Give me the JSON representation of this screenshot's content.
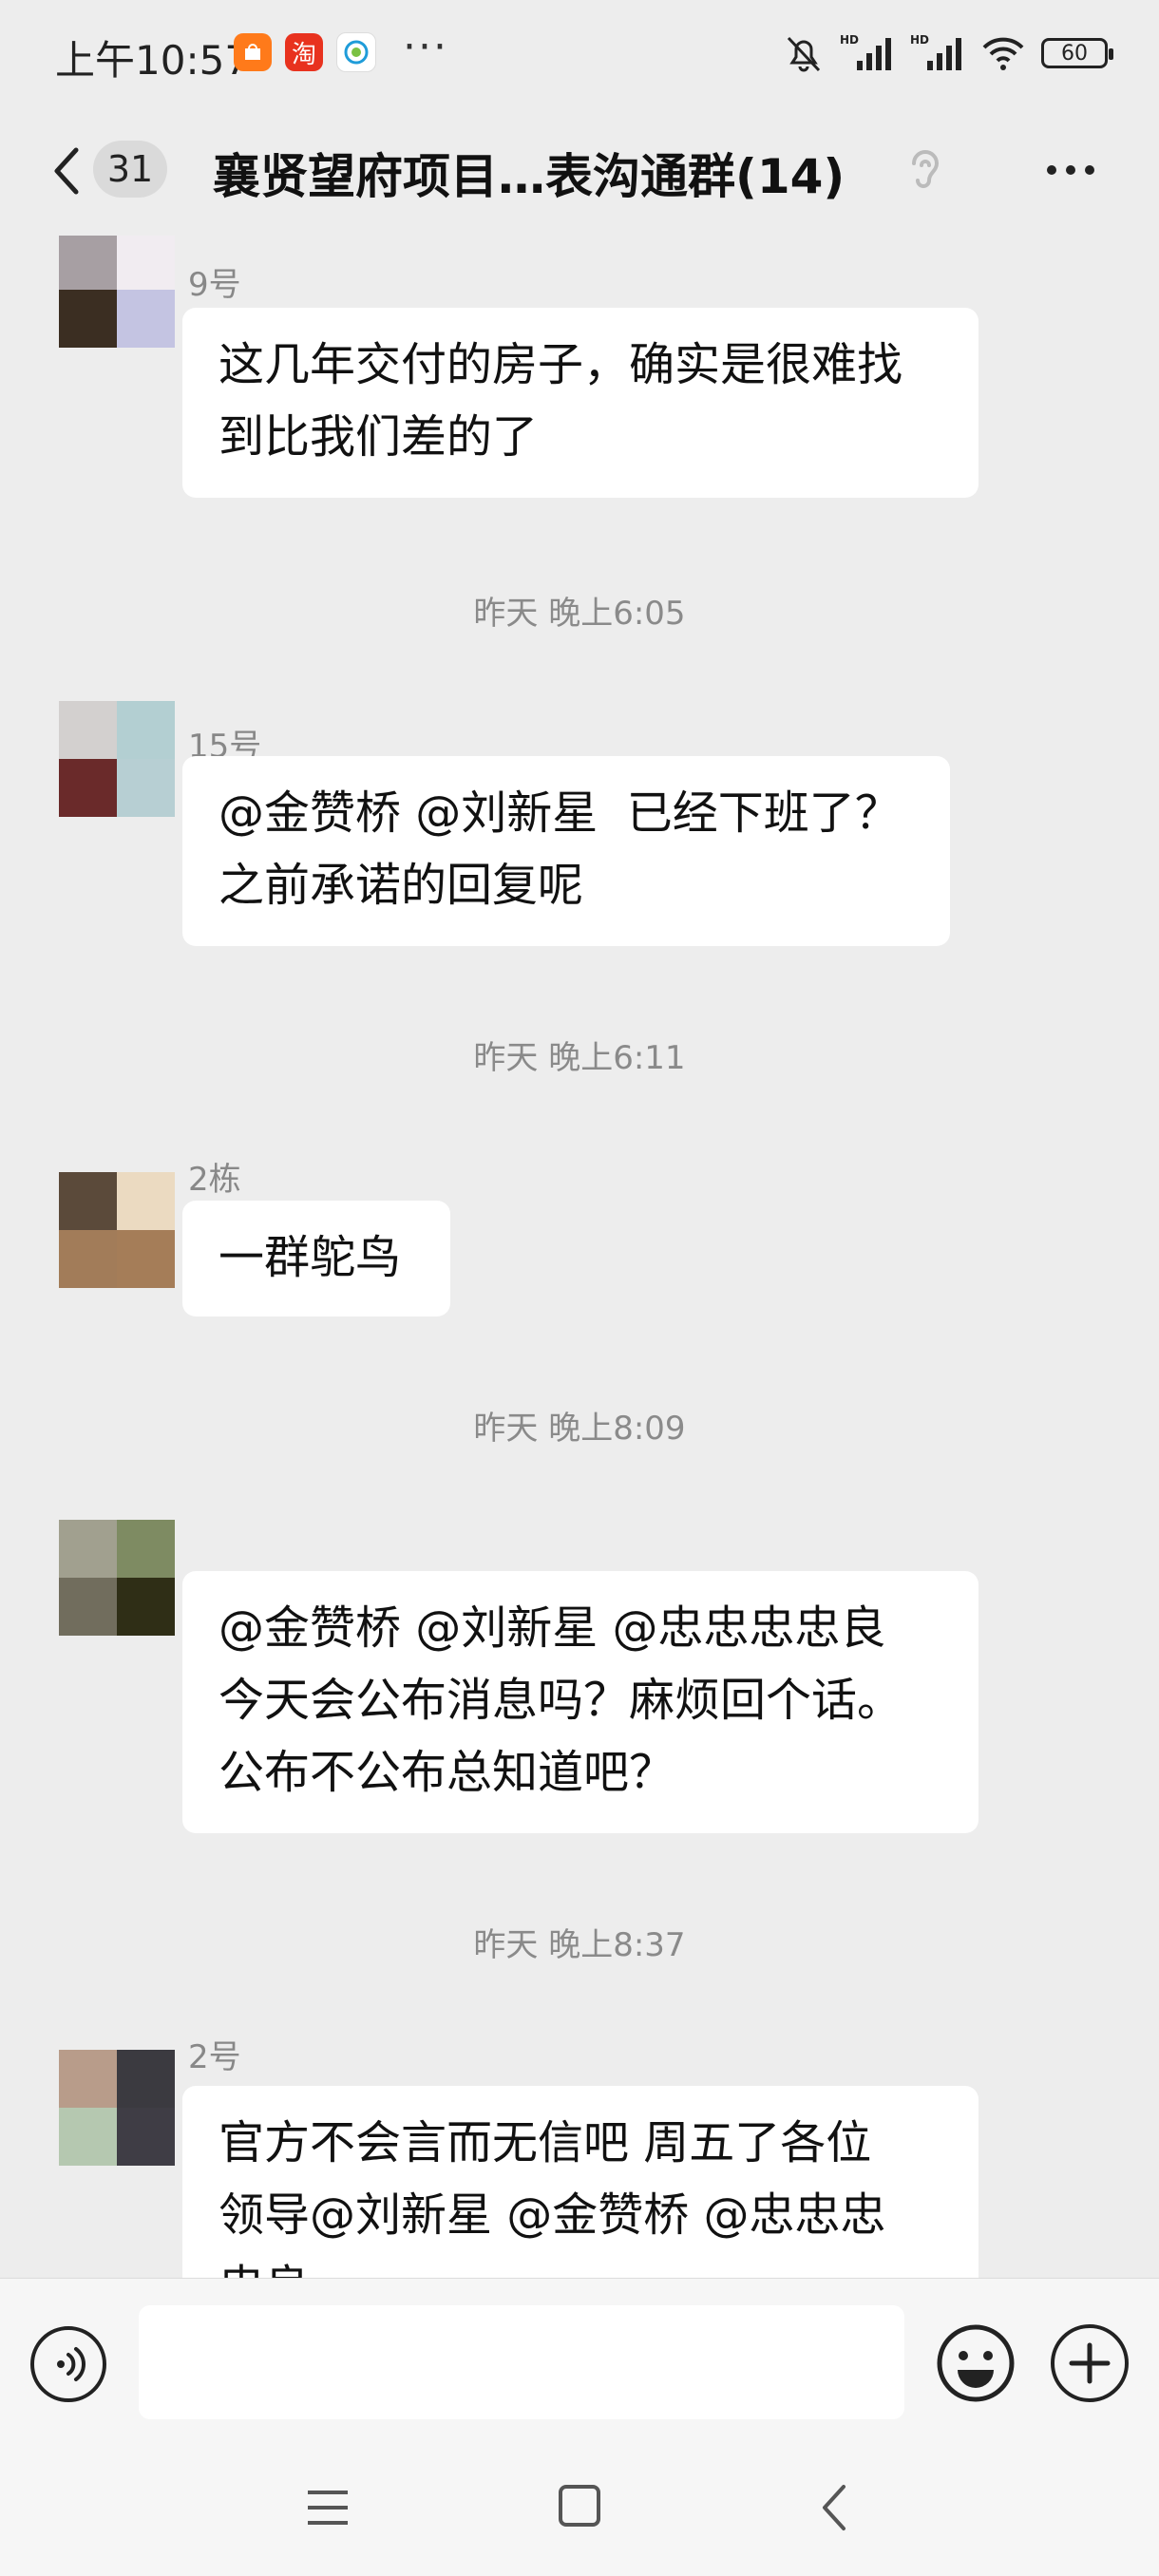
{
  "status_bar": {
    "time": "上午10:57",
    "app_icons": [
      {
        "name": "mi-store-icon",
        "color": "#ff7a1a",
        "glyph": "mi"
      },
      {
        "name": "taobao-icon",
        "color": "#e8321e",
        "glyph": "淘"
      },
      {
        "name": "china-mobile-icon",
        "color": "#ffffff",
        "glyph": ""
      }
    ],
    "more": "···",
    "signal_label_1": "HD",
    "signal_label_2": "HD",
    "battery": "60"
  },
  "header": {
    "unread_count": "31",
    "title": "襄贤望府项目…表沟通群(14)"
  },
  "messages": [
    {
      "sender": "9号",
      "text": "这几年交付的房子，确实是很难找\n到比我们差的了",
      "avatar_colors": [
        "#a79fa3",
        "#f1ecf1",
        "#3b2e22",
        "#c4c4e2"
      ]
    },
    {
      "timestamp": "昨天 晚上6:05"
    },
    {
      "sender": "15号",
      "text": "@金赞桥 @刘新星  已经下班了？\n之前承诺的回复呢",
      "avatar_colors": [
        "#d3d0cf",
        "#b3cfd2",
        "#6a2a2a",
        "#b7cfd3"
      ]
    },
    {
      "timestamp": "昨天 晚上6:11"
    },
    {
      "sender": "2栋",
      "text": "一群鸵鸟",
      "avatar_colors": [
        "#5b4a3a",
        "#ebdac1",
        "#a27c59",
        "#a57d58"
      ]
    },
    {
      "timestamp": "昨天 晚上8:09"
    },
    {
      "sender": "",
      "text": "@金赞桥 @刘新星 @忠忠忠忠良\n今天会公布消息吗？麻烦回个话。\n公布不公布总知道吧？",
      "avatar_colors": [
        "#a1a08f",
        "#7e8b62",
        "#716d5d",
        "#2f2e16"
      ]
    },
    {
      "timestamp": "昨天 晚上8:37"
    },
    {
      "sender": "2号",
      "text": "官方不会言而无信吧 周五了各位\n领导@刘新星 @金赞桥 @忠忠忠\n忠良",
      "avatar_colors": [
        "#b89c8a",
        "#3b3a40",
        "#b5c8b0",
        "#3f3d45"
      ]
    }
  ],
  "input": {
    "value": "",
    "placeholder": ""
  }
}
